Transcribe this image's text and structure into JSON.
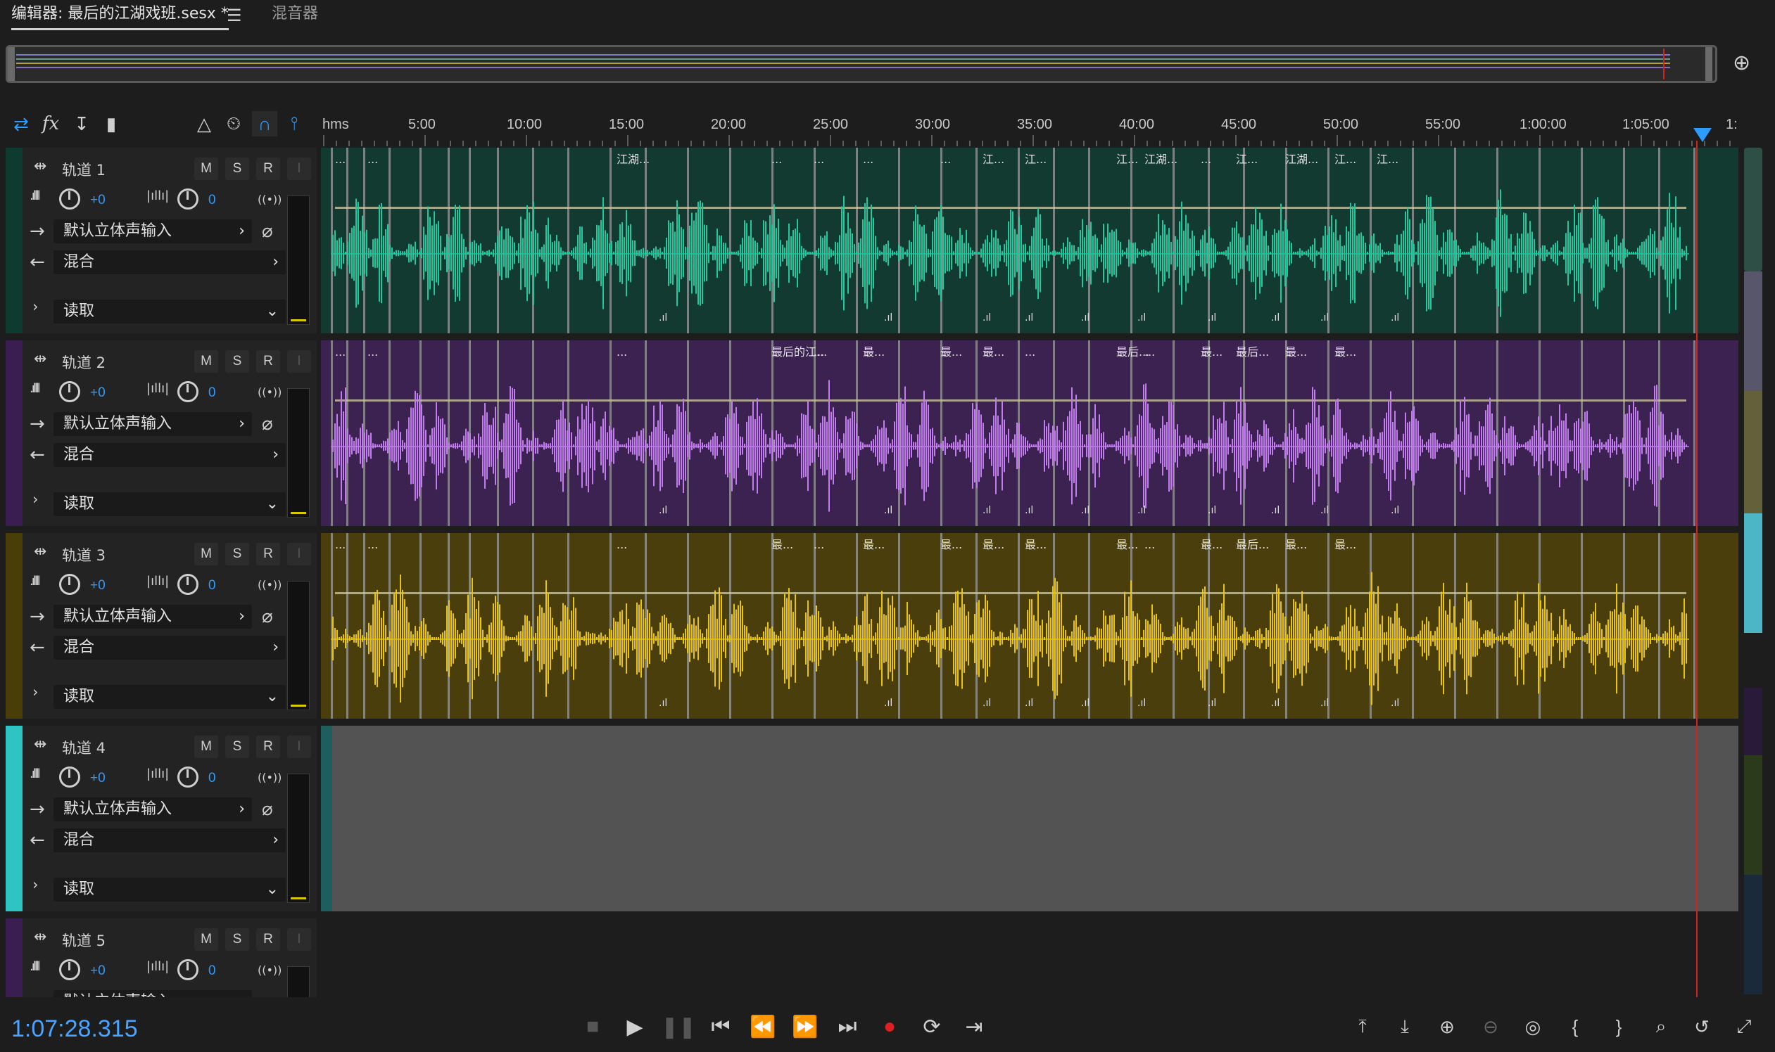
{
  "tabs": {
    "editor_label": "编辑器: 最后的江湖戏班.sesx *",
    "mixer_label": "混音器"
  },
  "colors": {
    "accent": "#2e9bff",
    "track1": "#0f3a2f",
    "track2": "#3a1e52",
    "track3": "#4a3e08",
    "track4": "#2ec4c4",
    "playhead": "#d22222"
  },
  "ruler": {
    "unit_label": "hms",
    "ticks": [
      "5:00",
      "10:00",
      "15:00",
      "20:00",
      "25:00",
      "30:00",
      "35:00",
      "40:00",
      "45:00",
      "50:00",
      "55:00",
      "1:00:00",
      "1:05:00",
      "1:"
    ]
  },
  "tracks": [
    {
      "name": "轨道 1",
      "volume": "+0",
      "pan": "0",
      "input": "默认立体声输入",
      "output": "混合",
      "automation": "读取",
      "clips": [
        "...",
        "...",
        "江湖...",
        "...",
        "...",
        "...",
        "...",
        "江...",
        "江...",
        "江...",
        "江湖...",
        "...",
        "江...",
        "江湖...",
        "江...",
        "江..."
      ]
    },
    {
      "name": "轨道 2",
      "volume": "+0",
      "pan": "0",
      "input": "默认立体声输入",
      "output": "混合",
      "automation": "读取",
      "clips": [
        "...",
        "...",
        "...",
        "最后的江...",
        "...",
        "最...",
        "最...",
        "最...",
        "...",
        "最后...",
        "...",
        "最...",
        "最后...",
        "最...",
        "最..."
      ]
    },
    {
      "name": "轨道 3",
      "volume": "+0",
      "pan": "0",
      "input": "默认立体声输入",
      "output": "混合",
      "automation": "读取",
      "clips": [
        "...",
        "...",
        "...",
        "最...",
        "...",
        "最...",
        "最...",
        "最...",
        "最...",
        "最...",
        "...",
        "最...",
        "最后...",
        "最...",
        "最..."
      ]
    },
    {
      "name": "轨道 4",
      "volume": "+0",
      "pan": "0",
      "input": "默认立体声输入",
      "output": "混合",
      "automation": "读取",
      "clips": []
    },
    {
      "name": "轨道 5",
      "volume": "+0",
      "pan": "0",
      "input": "默认立体声输入",
      "output": "",
      "automation": "",
      "clips": []
    }
  ],
  "buttons": {
    "mute": "M",
    "solo": "S",
    "record": "R",
    "input_monitor": "I"
  },
  "transport": {
    "timecode": "1:07:28.315"
  },
  "icons": {
    "toolbar": [
      "switch-arrows-icon",
      "fx-icon",
      "send-icon",
      "eq-icon",
      "metronome-icon",
      "time-stretch-icon",
      "snap-magnet-icon",
      "marker-icon"
    ],
    "transport": [
      "stop-icon",
      "play-icon",
      "pause-icon",
      "go-to-start-icon",
      "rewind-icon",
      "fast-forward-icon",
      "go-to-end-icon",
      "record-icon",
      "loop-icon",
      "skip-selection-icon"
    ],
    "zoom": [
      "zoom-in-amplitude-icon",
      "zoom-out-amplitude-icon",
      "zoom-in-time-icon",
      "zoom-out-time-icon",
      "zoom-full-icon",
      "zoom-in-start-icon",
      "zoom-in-end-icon",
      "zoom-selection-icon",
      "zoom-reset-icon",
      "zoom-tracks-icon"
    ]
  }
}
